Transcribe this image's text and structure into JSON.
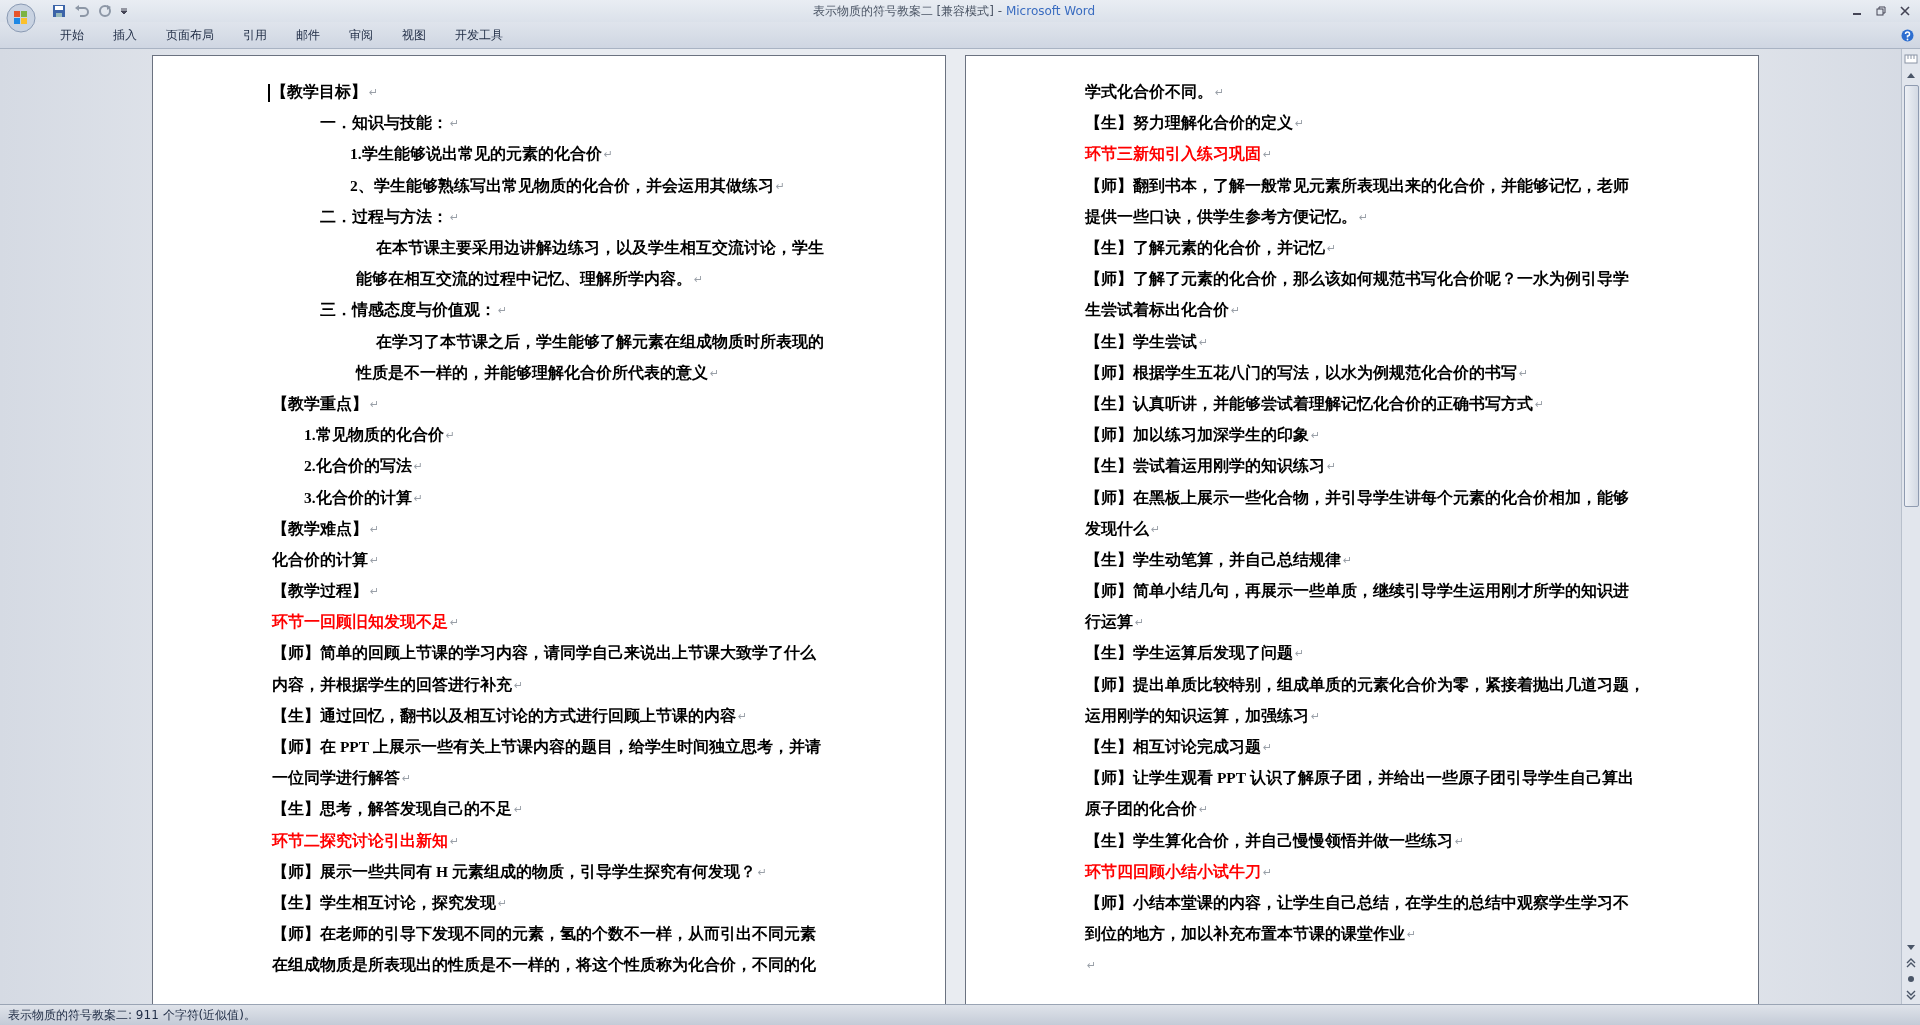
{
  "window": {
    "title": "表示物质的符号教案二 [兼容模式] - ",
    "app_name": "Microsoft Word"
  },
  "ribbon_tabs": [
    {
      "label": "开始",
      "selected": false
    },
    {
      "label": "插入",
      "selected": false
    },
    {
      "label": "页面布局",
      "selected": false
    },
    {
      "label": "引用",
      "selected": false
    },
    {
      "label": "邮件",
      "selected": false
    },
    {
      "label": "审阅",
      "selected": false
    },
    {
      "label": "视图",
      "selected": false
    },
    {
      "label": "开发工具",
      "selected": false
    }
  ],
  "pages": [
    {
      "lines": [
        {
          "kind": "heading",
          "text": "【教学目标】",
          "mark": "↵",
          "cursor": true
        },
        {
          "kind": "section",
          "text": "一．知识与技能：",
          "mark": "↵"
        },
        {
          "kind": "item",
          "text": "1.学生能够说出常见的元素的化合价",
          "mark": "↵"
        },
        {
          "kind": "item",
          "text": "2、学生能够熟练写出常见物质的化合价，并会运用其做练习",
          "mark": "↵"
        },
        {
          "kind": "section",
          "text": "二．过程与方法：",
          "mark": "↵"
        },
        {
          "kind": "para",
          "text": "在本节课主要采用边讲解边练习，以及学生相互交流讨论，学生"
        },
        {
          "kind": "para-cont",
          "text": "能够在相互交流的过程中记忆、理解所学内容。",
          "mark": "↵"
        },
        {
          "kind": "section",
          "text": "三．情感态度与价值观：",
          "mark": "↵"
        },
        {
          "kind": "para",
          "text": "在学习了本节课之后，学生能够了解元素在组成物质时所表现的"
        },
        {
          "kind": "para-cont",
          "text": "性质是不一样的，并能够理解化合价所代表的意义",
          "mark": "↵"
        },
        {
          "kind": "heading",
          "text": "【教学重点】",
          "mark": "↵"
        },
        {
          "kind": "point",
          "text": "1.常见物质的化合价",
          "mark": "↵"
        },
        {
          "kind": "point",
          "text": "2.化合价的写法",
          "mark": "↵"
        },
        {
          "kind": "point",
          "text": "3.化合价的计算",
          "mark": "↵"
        },
        {
          "kind": "heading",
          "text": "【教学难点】",
          "mark": "↵"
        },
        {
          "kind": "body",
          "text": "化合价的计算",
          "mark": "↵"
        },
        {
          "kind": "heading",
          "text": "【教学过程】",
          "mark": "↵"
        },
        {
          "kind": "stage",
          "text": "环节一回顾旧知发现不足",
          "mark": "↵"
        },
        {
          "kind": "body",
          "text": "【师】简单的回顾上节课的学习内容，请同学自己来说出上节课大致学了什么"
        },
        {
          "kind": "body",
          "text": "内容，并根据学生的回答进行补充",
          "mark": "↵"
        },
        {
          "kind": "body",
          "text": "【生】通过回忆，翻书以及相互讨论的方式进行回顾上节课的内容",
          "mark": "↵"
        },
        {
          "kind": "body",
          "text": "【师】在 PPT 上展示一些有关上节课内容的题目，给学生时间独立思考，并请"
        },
        {
          "kind": "body",
          "text": "一位同学进行解答",
          "mark": "↵"
        },
        {
          "kind": "body",
          "text": "【生】思考，解答发现自己的不足",
          "mark": "↵"
        },
        {
          "kind": "stage",
          "text": "环节二探究讨论引出新知",
          "mark": "↵"
        },
        {
          "kind": "body",
          "text": "【师】展示一些共同有 H 元素组成的物质，引导学生探究有何发现？",
          "mark": "↵"
        },
        {
          "kind": "body",
          "text": "【生】学生相互讨论，探究发现",
          "mark": "↵"
        },
        {
          "kind": "body",
          "text": "【师】在老师的引导下发现不同的元素，氢的个数不一样，从而引出不同元素"
        },
        {
          "kind": "body",
          "text": "在组成物质是所表现出的性质是不一样的，将这个性质称为化合价，不同的化"
        }
      ]
    },
    {
      "lines": [
        {
          "kind": "body",
          "text": "学式化合价不同。",
          "mark": "↵"
        },
        {
          "kind": "body",
          "text": "【生】努力理解化合价的定义",
          "mark": "↵"
        },
        {
          "kind": "stage",
          "text": "环节三新知引入练习巩固",
          "mark": "↵"
        },
        {
          "kind": "body",
          "text": "【师】翻到书本，了解一般常见元素所表现出来的化合价，并能够记忆，老师"
        },
        {
          "kind": "body",
          "text": "提供一些口诀，供学生参考方便记忆。",
          "mark": "↵"
        },
        {
          "kind": "body",
          "text": "【生】了解元素的化合价，并记忆",
          "mark": "↵"
        },
        {
          "kind": "body",
          "text": "【师】了解了元素的化合价，那么该如何规范书写化合价呢？一水为例引导学"
        },
        {
          "kind": "body",
          "text": "生尝试着标出化合价",
          "mark": "↵"
        },
        {
          "kind": "body",
          "text": "【生】学生尝试",
          "mark": "↵"
        },
        {
          "kind": "body",
          "text": "【师】根据学生五花八门的写法，以水为例规范化合价的书写",
          "mark": "↵"
        },
        {
          "kind": "body",
          "text": "【生】认真听讲，并能够尝试着理解记忆化合价的正确书写方式",
          "mark": "↵"
        },
        {
          "kind": "body",
          "text": "【师】加以练习加深学生的印象",
          "mark": "↵"
        },
        {
          "kind": "body",
          "text": "【生】尝试着运用刚学的知识练习",
          "mark": "↵"
        },
        {
          "kind": "body",
          "text": "【师】在黑板上展示一些化合物，并引导学生讲每个元素的化合价相加，能够"
        },
        {
          "kind": "body",
          "text": "发现什么",
          "mark": "↵"
        },
        {
          "kind": "body",
          "text": "【生】学生动笔算，并自己总结规律",
          "mark": "↵"
        },
        {
          "kind": "body",
          "text": "【师】简单小结几句，再展示一些单质，继续引导学生运用刚才所学的知识进"
        },
        {
          "kind": "body",
          "text": "行运算",
          "mark": "↵"
        },
        {
          "kind": "body",
          "text": "【生】学生运算后发现了问题",
          "mark": "↵"
        },
        {
          "kind": "body",
          "text": "【师】提出单质比较特别，组成单质的元素化合价为零，紧接着抛出几道习题，"
        },
        {
          "kind": "body",
          "text": "运用刚学的知识运算，加强练习",
          "mark": "↵"
        },
        {
          "kind": "body",
          "text": "【生】相互讨论完成习题",
          "mark": "↵"
        },
        {
          "kind": "body",
          "text": "【师】让学生观看 PPT 认识了解原子团，并给出一些原子团引导学生自己算出"
        },
        {
          "kind": "body",
          "text": "原子团的化合价",
          "mark": "↵"
        },
        {
          "kind": "body",
          "text": "【生】学生算化合价，并自己慢慢领悟并做一些练习",
          "mark": "↵"
        },
        {
          "kind": "stage",
          "text": "环节四回顾小结小试牛刀",
          "mark": "↵"
        },
        {
          "kind": "body",
          "text": "【师】小结本堂课的内容，让学生自己总结，在学生的总结中观察学生学习不"
        },
        {
          "kind": "body",
          "text": "到位的地方，加以补充布置本节课的课堂作业",
          "mark": "↵"
        },
        {
          "kind": "body",
          "mark": "↵"
        }
      ]
    }
  ],
  "status_bar": "表示物质的符号教案二: 911 个字符(近似值)。"
}
